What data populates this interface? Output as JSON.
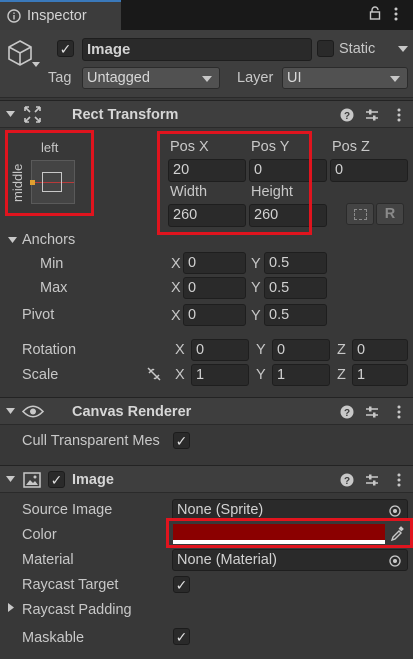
{
  "tab": {
    "title": "Inspector",
    "lock_icon": "lock-icon",
    "menu_icon": "kebab-menu-icon"
  },
  "gameobject": {
    "active": true,
    "name": "Image",
    "static_label": "Static",
    "tag_label": "Tag",
    "tag_value": "Untagged",
    "layer_label": "Layer",
    "layer_value": "UI"
  },
  "rect_transform": {
    "title": "Rect Transform",
    "anchor_h": "left",
    "anchor_v": "middle",
    "pos_x_label": "Pos X",
    "pos_x": "20",
    "pos_y_label": "Pos Y",
    "pos_y": "0",
    "pos_z_label": "Pos Z",
    "pos_z": "0",
    "width_label": "Width",
    "width": "260",
    "height_label": "Height",
    "height": "260",
    "r_button": "R",
    "anchors_label": "Anchors",
    "min_label": "Min",
    "min_x": "0",
    "min_y": "0.5",
    "max_label": "Max",
    "max_x": "0",
    "max_y": "0.5",
    "pivot_label": "Pivot",
    "pivot_x": "0",
    "pivot_y": "0.5",
    "rotation_label": "Rotation",
    "rot_x": "0",
    "rot_y": "0",
    "rot_z": "0",
    "scale_label": "Scale",
    "scale_x": "1",
    "scale_y": "1",
    "scale_z": "1",
    "x": "X",
    "y": "Y",
    "z": "Z"
  },
  "canvas_renderer": {
    "title": "Canvas Renderer",
    "cull_label": "Cull Transparent Mes",
    "cull_checked": true
  },
  "image": {
    "title": "Image",
    "enabled": true,
    "source_label": "Source Image",
    "source_value": "None (Sprite)",
    "color_label": "Color",
    "color_value": "#8b0000",
    "material_label": "Material",
    "material_value": "None (Material)",
    "raycast_target_label": "Raycast Target",
    "raycast_target": true,
    "raycast_padding_label": "Raycast Padding",
    "maskable_label": "Maskable",
    "maskable": true
  },
  "colors": {
    "highlight": "#e0141e",
    "accent": "#3a79bb"
  }
}
